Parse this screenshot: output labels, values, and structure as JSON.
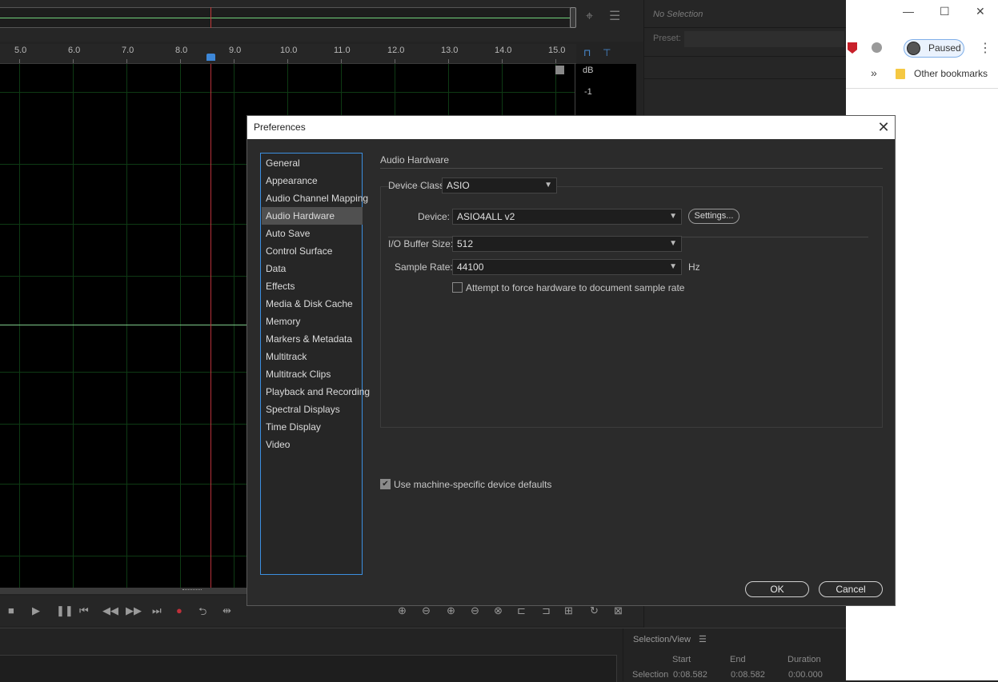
{
  "editor": {
    "ruler_labels": [
      "5.0",
      "6.0",
      "7.0",
      "8.0",
      "9.0",
      "10.0",
      "11.0",
      "12.0",
      "13.0",
      "14.0",
      "15.0"
    ],
    "db_label": "dB",
    "db_value": "-1"
  },
  "properties_panel": {
    "no_selection": "No Selection",
    "preset_label": "Preset:"
  },
  "selection_view": {
    "title": "Selection/View",
    "col_start": "Start",
    "col_end": "End",
    "col_duration": "Duration",
    "row_label": "Selection",
    "start": "0:08.582",
    "end": "0:08.582",
    "duration": "0:00.000"
  },
  "browser": {
    "paused_label": "Paused",
    "overflow_label": "»",
    "other_bookmarks": "Other bookmarks"
  },
  "dialog": {
    "title": "Preferences",
    "close_glyph": "✕",
    "categories": [
      "General",
      "Appearance",
      "Audio Channel Mapping",
      "Audio Hardware",
      "Auto Save",
      "Control Surface",
      "Data",
      "Effects",
      "Media & Disk Cache",
      "Memory",
      "Markers & Metadata",
      "Multitrack",
      "Multitrack Clips",
      "Playback and Recording",
      "Spectral Displays",
      "Time Display",
      "Video"
    ],
    "selected_category": "Audio Hardware",
    "section_title": "Audio Hardware",
    "device_class_label": "Device Class:",
    "device_class_value": "ASIO",
    "device_label": "Device:",
    "device_value": "ASIO4ALL v2",
    "settings_button": "Settings...",
    "buffer_label": "I/O Buffer Size:",
    "buffer_value": "512",
    "sample_rate_label": "Sample Rate:",
    "sample_rate_value": "44100",
    "sample_rate_unit": "Hz",
    "force_rate_label": "Attempt to force hardware to document sample rate",
    "force_rate_checked": false,
    "machine_defaults_label": "Use machine-specific device defaults",
    "machine_defaults_checked": true,
    "ok_button": "OK",
    "cancel_button": "Cancel"
  },
  "colors": {
    "accent": "#3c8fe0",
    "playhead": "#b8323b",
    "waveform": "#7fc98a"
  }
}
